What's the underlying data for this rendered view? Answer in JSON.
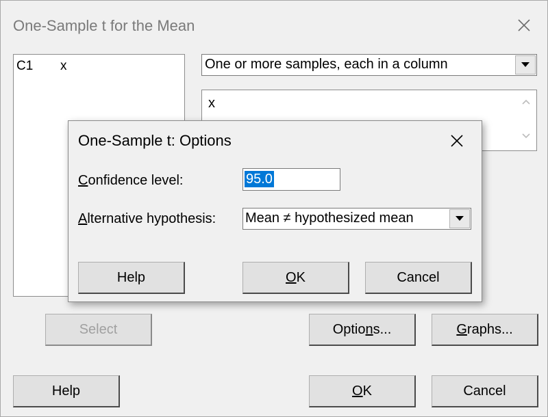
{
  "main_dialog": {
    "title": "One-Sample t for the Mean",
    "variables": [
      {
        "column": "C1",
        "name": "x"
      }
    ],
    "mode_select": {
      "selected": "One or more samples, each in a column"
    },
    "samples_value": "x",
    "buttons": {
      "select": "Select",
      "options_before": "Optio",
      "options_mnemonic": "n",
      "options_after": "s...",
      "graphs_mnemonic": "G",
      "graphs_after": "raphs...",
      "help": "Help",
      "ok_mnemonic": "O",
      "ok_after": "K",
      "cancel": "Cancel"
    }
  },
  "options_dialog": {
    "title": "One-Sample t: Options",
    "confidence": {
      "label_mnemonic": "C",
      "label_after": "onfidence level:",
      "value": "95.0"
    },
    "alternative": {
      "label_mnemonic": "A",
      "label_after": "lternative hypothesis:",
      "selected": "Mean ≠ hypothesized mean"
    },
    "buttons": {
      "help": "Help",
      "ok_mnemonic": "O",
      "ok_after": "K",
      "cancel": "Cancel"
    }
  },
  "colors": {
    "selection_highlight": "#0078d7",
    "dialog_background": "#f0f0f0",
    "button_face": "#e1e1e1"
  }
}
